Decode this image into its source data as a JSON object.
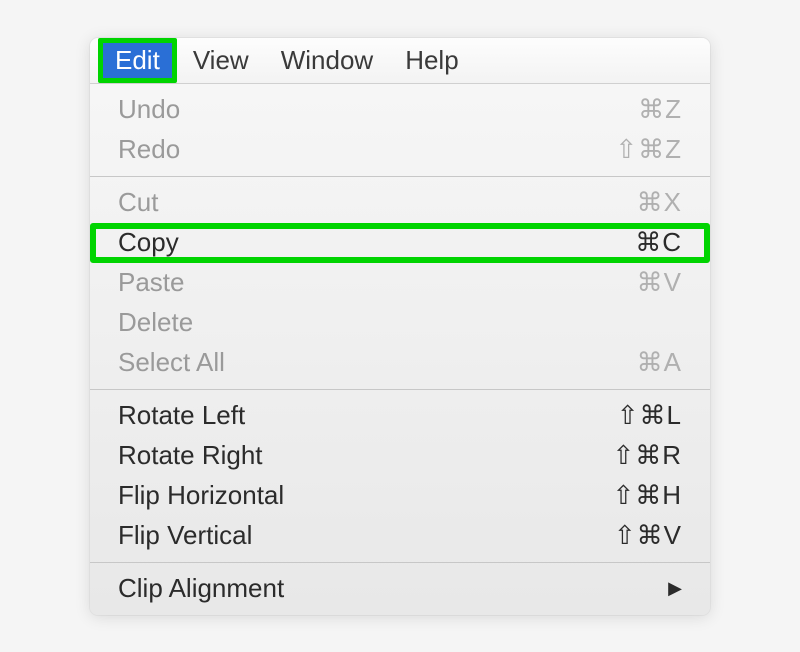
{
  "menubar": {
    "items": [
      {
        "label": "Edit",
        "active": true
      },
      {
        "label": "View",
        "active": false
      },
      {
        "label": "Window",
        "active": false
      },
      {
        "label": "Help",
        "active": false
      }
    ]
  },
  "menu": {
    "groups": [
      [
        {
          "label": "Undo",
          "shortcut": "⌘Z",
          "disabled": true,
          "highlighted": false
        },
        {
          "label": "Redo",
          "shortcut": "⇧⌘Z",
          "disabled": true,
          "highlighted": false
        }
      ],
      [
        {
          "label": "Cut",
          "shortcut": "⌘X",
          "disabled": true,
          "highlighted": false
        },
        {
          "label": "Copy",
          "shortcut": "⌘C",
          "disabled": false,
          "highlighted": true
        },
        {
          "label": "Paste",
          "shortcut": "⌘V",
          "disabled": true,
          "highlighted": false
        },
        {
          "label": "Delete",
          "shortcut": "",
          "disabled": true,
          "highlighted": false
        },
        {
          "label": "Select All",
          "shortcut": "⌘A",
          "disabled": true,
          "highlighted": false
        }
      ],
      [
        {
          "label": "Rotate Left",
          "shortcut": "⇧⌘L",
          "disabled": false,
          "highlighted": false
        },
        {
          "label": "Rotate Right",
          "shortcut": "⇧⌘R",
          "disabled": false,
          "highlighted": false
        },
        {
          "label": "Flip Horizontal",
          "shortcut": "⇧⌘H",
          "disabled": false,
          "highlighted": false
        },
        {
          "label": "Flip Vertical",
          "shortcut": "⇧⌘V",
          "disabled": false,
          "highlighted": false
        }
      ],
      [
        {
          "label": "Clip Alignment",
          "shortcut": "",
          "disabled": false,
          "highlighted": false,
          "submenu": true
        }
      ]
    ]
  }
}
